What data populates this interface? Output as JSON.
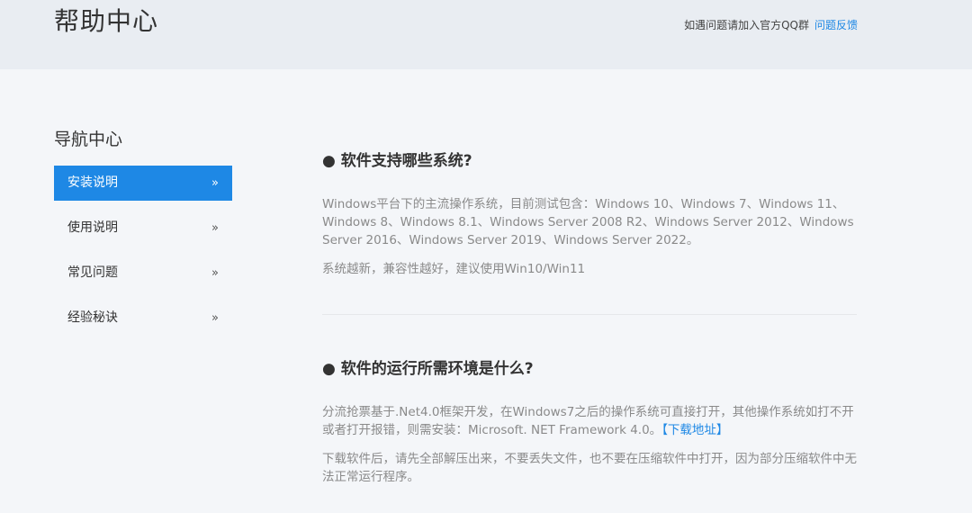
{
  "header": {
    "title": "帮助中心",
    "notice": "如遇问题请加入官方QQ群",
    "feedback_link": "问题反馈"
  },
  "nav": {
    "title": "导航中心",
    "items": [
      {
        "label": "安装说明",
        "arrow": "»",
        "active": true
      },
      {
        "label": "使用说明",
        "arrow": "»",
        "active": false
      },
      {
        "label": "常见问题",
        "arrow": "»",
        "active": false
      },
      {
        "label": "经验秘诀",
        "arrow": "»",
        "active": false
      }
    ]
  },
  "sections": [
    {
      "title": "● 软件支持哪些系统?",
      "p1": "Windows平台下的主流操作系统，目前测试包含：Windows 10、Windows 7、Windows 11、Windows 8、Windows 8.1、Windows Server 2008 R2、Windows Server 2012、Windows Server 2016、Windows Server 2019、Windows Server 2022。",
      "p2": "系统越新，兼容性越好，建议使用Win10/Win11"
    },
    {
      "title": "● 软件的运行所需环境是什么?",
      "p1": "分流抢票基于.Net4.0框架开发，在Windows7之后的操作系统可直接打开，其他操作系统如打不开或者打开报错，则需安装：Microsoft. NET Framework 4.0。",
      "p1_link": "【下载地址】",
      "p2": "下载软件后，请先全部解压出来，不要丢失文件，也不要在压缩软件中打开，因为部分压缩软件中无法正常运行程序。"
    }
  ],
  "colors": {
    "accent": "#1e88e5",
    "header_bg": "#e9edf2",
    "page_bg": "#f4f6f9",
    "body_text": "#8a8a8a"
  }
}
